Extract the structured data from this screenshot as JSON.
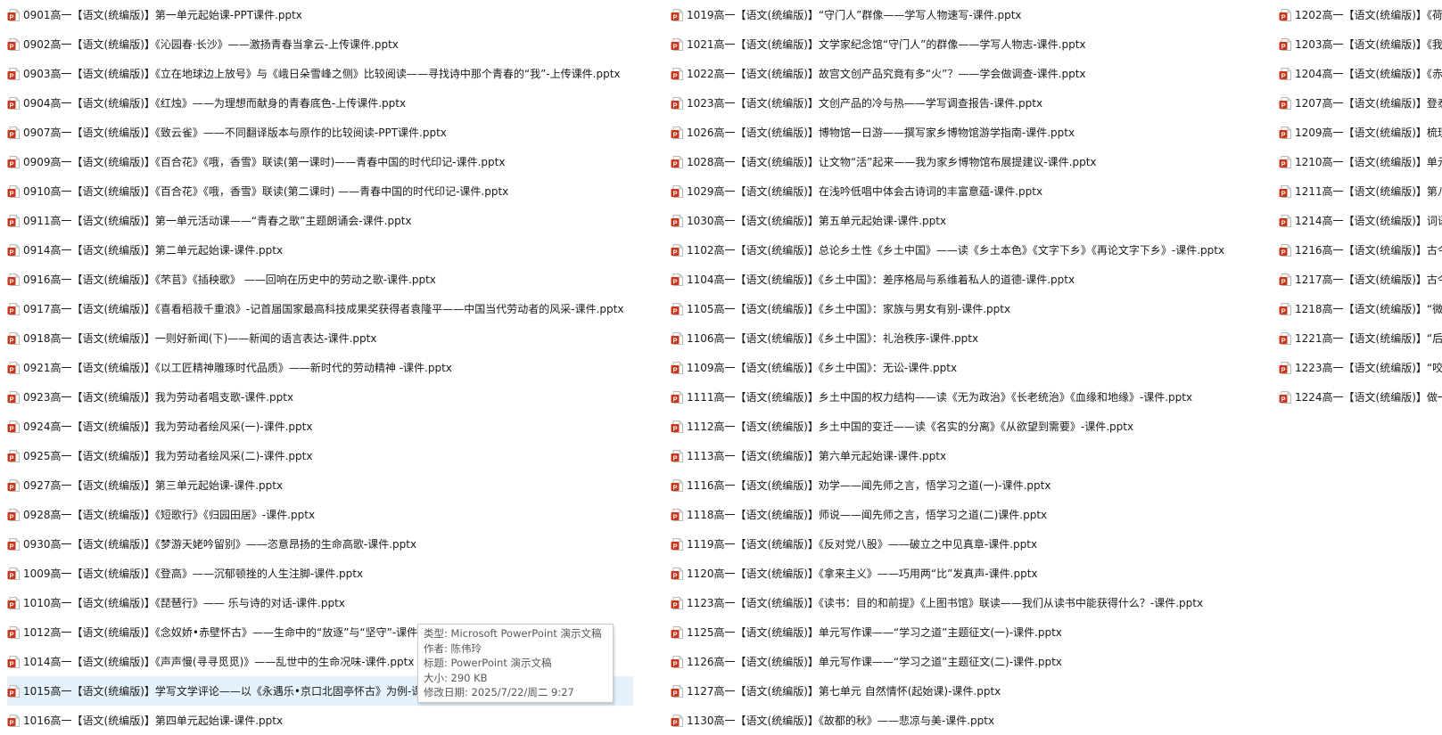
{
  "icon": "powerpoint-file-icon",
  "colors": {
    "icon_red": "#c9361a",
    "selected_bg": "#e5f1fb"
  },
  "column1": [
    "0901高一【语文(统编版)】第一单元起始课-PPT课件.pptx",
    "0902高一【语文(统编版)】《沁园春·长沙》——激扬青春当拿云-上传课件.pptx",
    "0903高一【语文(统编版)】《立在地球边上放号》与《峨日朵雪峰之侧》比较阅读——寻找诗中那个青春的“我”-上传课件.pptx",
    "0904高一【语文(统编版)】《红烛》——为理想而献身的青春底色-上传课件.pptx",
    "0907高一【语文(统编版)】《致云雀》——不同翻译版本与原作的比较阅读-PPT课件.pptx",
    "0909高一【语文(统编版)】《百合花》《哦，香雪》联读(第一课时)——青春中国的时代印记-课件.pptx",
    "0910高一【语文(统编版)】《百合花》《哦，香雪》联读(第二课时) ——青春中国的时代印记-课件.pptx",
    "0911高一【语文(统编版)】第一单元活动课——“青春之歌”主题朗诵会-课件.pptx",
    "0914高一【语文(统编版)】第二单元起始课-课件.pptx",
    "0916高一【语文(统编版)】《芣苢》《插秧歌》 ——回响在历史中的劳动之歌-课件.pptx",
    "0917高一【语文(统编版)】《喜看稻菽千重浪》-记首届国家最高科技成果奖获得者袁隆平——中国当代劳动者的风采-课件.pptx",
    "0918高一【语文(统编版)】一则好新闻(下)——新闻的语言表达-课件.pptx",
    "0921高一【语文(统编版)】《以工匠精神雕琢时代品质》——新时代的劳动精神 -课件.pptx",
    "0923高一【语文(统编版)】我为劳动者唱支歌-课件.pptx",
    "0924高一【语文(统编版)】我为劳动者绘风采(一)-课件.pptx",
    "0925高一【语文(统编版)】我为劳动者绘风采(二)-课件.pptx",
    "0927高一【语文(统编版)】第三单元起始课-课件.pptx",
    "0928高一【语文(统编版)】《短歌行》《归园田居》-课件.pptx",
    "0930高一【语文(统编版)】《梦游天姥吟留别》——恣意昂扬的生命高歌-课件.pptx",
    "1009高一【语文(统编版)】《登高》——沉郁顿挫的人生注脚-课件.pptx",
    "1010高一【语文(统编版)】《琵琶行》—— 乐与诗的对话-课件.pptx",
    "1012高一【语文(统编版)】《念奴娇•赤壁怀古》——生命中的“放逐”与“坚守”-课件.",
    "1014高一【语文(统编版)】《声声慢(寻寻觅觅)》——乱世中的生命况味-课件.pptx",
    "1015高一【语文(统编版)】学写文学评论——以《永遇乐•京口北固亭怀古》为例-课",
    "1016高一【语文(统编版)】第四单元起始课-课件.pptx"
  ],
  "column2": [
    "1019高一【语文(统编版)】“守门人”群像——学写人物速写-课件.pptx",
    "1021高一【语文(统编版)】文学家纪念馆“守门人”的群像——学写人物志-课件.pptx",
    "1022高一【语文(统编版)】故宫文创产品究竟有多“火”？——学会做调查-课件.pptx",
    "1023高一【语文(统编版)】文创产品的冷与热——学写调查报告-课件.pptx",
    "1026高一【语文(统编版)】博物馆一日游——撰写家乡博物馆游学指南-课件.pptx",
    "1028高一【语文(统编版)】让文物“活”起来——我为家乡博物馆布展提建议-课件.pptx",
    "1029高一【语文(统编版)】在浅吟低唱中体会古诗词的丰富意蕴-课件.pptx",
    "1030高一【语文(统编版)】第五单元起始课-课件.pptx",
    "1102高一【语文(统编版)】总论乡土性《乡土中国》——读《乡土本色》《文字下乡》《再论文字下乡》-课件.pptx",
    "1104高一【语文(统编版)】《乡土中国》：差序格局与系维着私人的道德-课件.pptx",
    "1105高一【语文(统编版)】《乡土中国》：家族与男女有别-课件.pptx",
    "1106高一【语文(统编版)】《乡土中国》：礼治秩序-课件.pptx",
    "1109高一【语文(统编版)】《乡土中国》：无讼-课件.pptx",
    "1111高一【语文(统编版)】乡土中国的权力结构——读《无为政治》《长老统治》《血缘和地缘》-课件.pptx",
    "1112高一【语文(统编版)】乡土中国的变迁——读《名实的分离》《从欲望到需要》-课件.pptx",
    "1113高一【语文(统编版)】第六单元起始课-课件.pptx",
    "1116高一【语文(统编版)】劝学——闻先师之言，悟学习之道(一)-课件.pptx",
    "1118高一【语文(统编版)】师说——闻先师之言，悟学习之道(二)课件.pptx",
    "1119高一【语文(统编版)】《反对党八股》——破立之中见真章-课件.pptx",
    "1120高一【语文(统编版)】《拿来主义》——巧用两“比”发真声-课件.pptx",
    "1123高一【语文(统编版)】《读书：目的和前提》《上图书馆》联读——我们从读书中能获得什么？-课件.pptx",
    "1125高一【语文(统编版)】单元写作课——“学习之道”主题征文(一)-课件.pptx",
    "1126高一【语文(统编版)】单元写作课——“学习之道”主题征文(二)-课件.pptx",
    "1127高一【语文(统编版)】第七单元 自然情怀(起始课)-课件.pptx",
    "1130高一【语文(统编版)】《故都的秋》——悲凉与美-课件.pptx"
  ],
  "column3": [
    "1202高一【语文(统编版)】《荷",
    "1203高一【语文(统编版)】《我",
    "1204高一【语文(统编版)】《赤",
    "1207高一【语文(统编版)】登泰",
    "1209高一【语文(统编版)】梳理",
    "1210高一【语文(统编版)】单元",
    "1211高一【语文(统编版)】第八",
    "1214高一【语文(统编版)】词语",
    "1216高一【语文(统编版)】古今",
    "1217高一【语文(统编版)】古今",
    "1218高一【语文(统编版)】“微写",
    "1221高一【语文(统编版)】“后起",
    "1223高一【语文(统编版)】“咬文",
    "1224高一【语文(统编版)】做一"
  ],
  "tooltip": {
    "type": "类型: Microsoft PowerPoint 演示文稿",
    "author": "作者: 陈伟玲",
    "title": "标题: PowerPoint 演示文稿",
    "size": "大小: 290 KB",
    "modified": "修改日期: 2025/7/22/周二 9:27"
  }
}
